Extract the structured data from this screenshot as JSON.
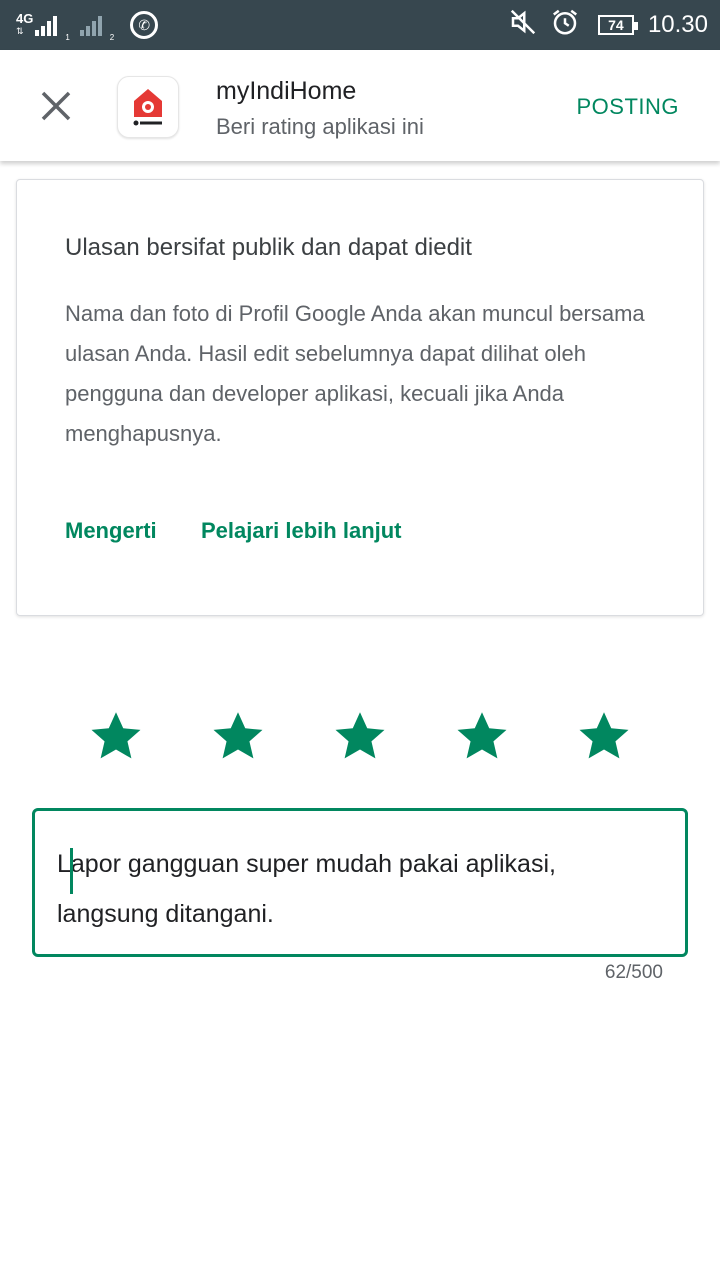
{
  "status_bar": {
    "network_type": "4G",
    "sim1_index": "1",
    "sim2_index": "2",
    "battery_level": "74",
    "time": "10.30",
    "icons": [
      "signal-icon",
      "whatsapp-icon",
      "mute-icon",
      "alarm-icon",
      "battery-icon"
    ]
  },
  "header": {
    "app_name": "myIndiHome",
    "subtitle": "Beri rating aplikasi ini",
    "post_label": "POSTING"
  },
  "notice_card": {
    "title": "Ulasan bersifat publik dan dapat diedit",
    "body": "Nama dan foto di Profil Google Anda akan muncul bersama ulasan Anda. Hasil edit sebelumnya dapat dilihat oleh pengguna dan developer aplikasi, kecuali jika Anda menghapusnya.",
    "understand_label": "Mengerti",
    "learn_more_label": "Pelajari lebih lanjut"
  },
  "rating": {
    "value": 5,
    "max": 5
  },
  "review": {
    "text": "Lapor gangguan super mudah pakai aplikasi, langsung ditangani.",
    "counter": "62/500"
  },
  "colors": {
    "accent": "#01875f",
    "status_bar": "#37474f"
  }
}
